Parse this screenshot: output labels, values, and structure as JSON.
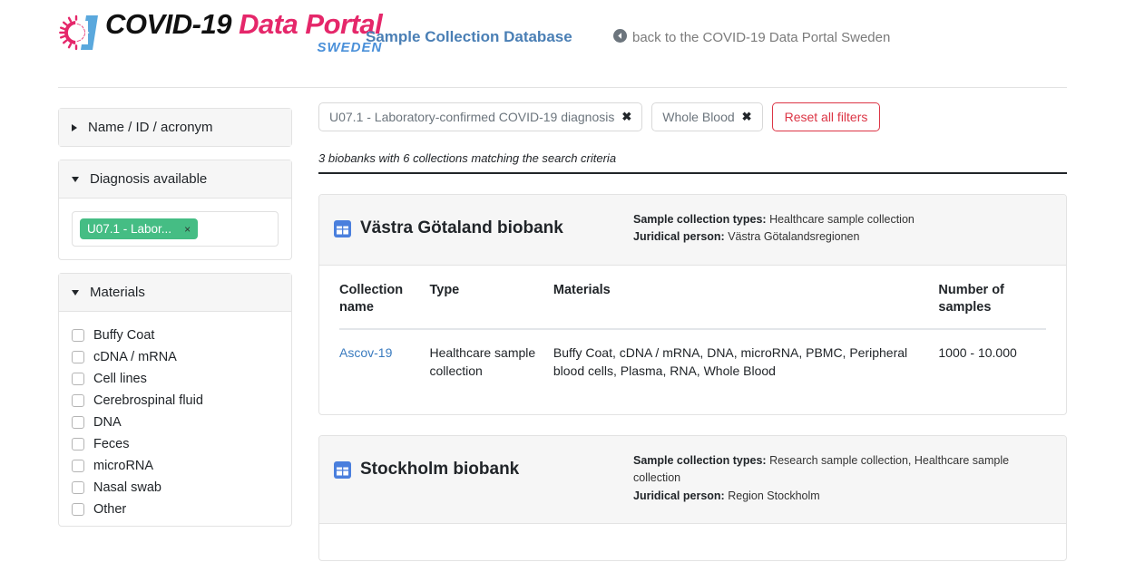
{
  "header": {
    "logo": {
      "icon": "covid-virus-icon",
      "line1_a": "COVID-19",
      "line1_b": "Data Portal",
      "line2": "SWEDEN"
    },
    "title": "Sample Collection Database",
    "back_link": "back to the COVID-19 Data Portal Sweden",
    "back_icon": "arrow-circle-left-icon"
  },
  "sidebar": {
    "panels": [
      {
        "label": "Name / ID / acronym",
        "expanded": false
      },
      {
        "label": "Diagnosis available",
        "expanded": true
      },
      {
        "label": "Materials",
        "expanded": true
      }
    ],
    "diagnosis_tag": {
      "label": "U07.1 - Labor...",
      "remove": "×"
    },
    "materials": [
      "Buffy Coat",
      "cDNA / mRNA",
      "Cell lines",
      "Cerebrospinal fluid",
      "DNA",
      "Feces",
      "microRNA",
      "Nasal swab",
      "Other"
    ]
  },
  "filters": {
    "pills": [
      {
        "label": "U07.1 - Laboratory-confirmed COVID-19 diagnosis",
        "remove": "✖"
      },
      {
        "label": "Whole Blood",
        "remove": "✖"
      }
    ],
    "reset_label": "Reset all filters"
  },
  "results": {
    "summary": "3 biobanks with 6 collections matching the search criteria"
  },
  "biobanks": [
    {
      "name": "Västra Götaland biobank",
      "icon": "table-grid-icon",
      "types_label": "Sample collection types:",
      "types_value": "Healthcare sample collection",
      "person_label": "Juridical person:",
      "person_value": "Västra Götalandsregionen",
      "table": {
        "columns": [
          "Collection name",
          "Type",
          "Materials",
          "Number of samples"
        ],
        "rows": [
          {
            "name": "Ascov-19",
            "type": "Healthcare sample collection",
            "materials": "Buffy Coat, cDNA / mRNA, DNA, microRNA, PBMC, Peripheral blood cells, Plasma, RNA, Whole Blood",
            "samples": "1000 - 10.000"
          }
        ]
      }
    },
    {
      "name": "Stockholm biobank",
      "icon": "table-grid-icon",
      "types_label": "Sample collection types:",
      "types_value": "Research sample collection, Healthcare sample collection",
      "person_label": "Juridical person:",
      "person_value": "Region Stockholm"
    }
  ],
  "colors": {
    "brand_pink": "#e5276a",
    "brand_blue": "#4a90d9",
    "title_blue": "#4a7fb5",
    "tag_green": "#45bd84",
    "reset_red": "#dc3545",
    "link_blue": "#3a7bbf"
  }
}
